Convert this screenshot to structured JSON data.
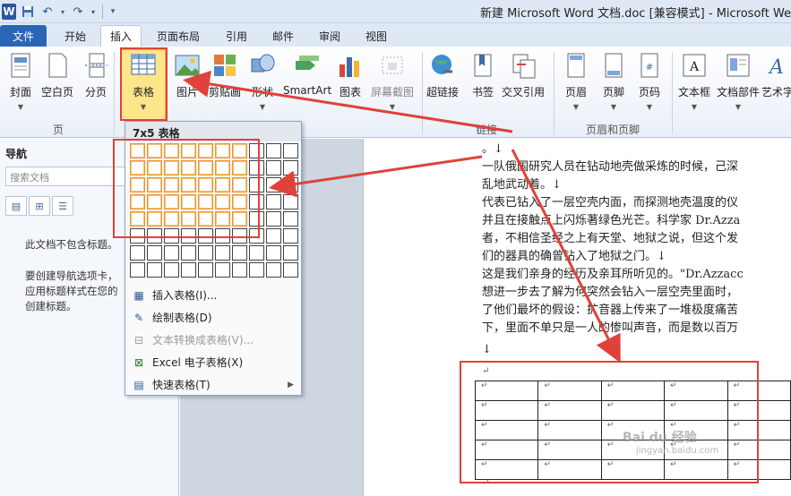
{
  "titlebar": {
    "logo": "W",
    "title": "新建 Microsoft Word 文档.doc [兼容模式] - Microsoft We"
  },
  "tabs": [
    {
      "label": "文件",
      "x": 0
    },
    {
      "label": "开始"
    },
    {
      "label": "插入"
    },
    {
      "label": "页面布局"
    },
    {
      "label": "引用"
    },
    {
      "label": "邮件"
    },
    {
      "label": "审阅"
    },
    {
      "label": "视图"
    }
  ],
  "ribbon": {
    "buttons": [
      {
        "label": "封面",
        "icon": "cover-page-icon"
      },
      {
        "label": "空白页",
        "icon": "blank-page-icon"
      },
      {
        "label": "分页",
        "icon": "page-break-icon"
      },
      {
        "label": "表格",
        "icon": "table-icon"
      },
      {
        "label": "图片",
        "icon": "picture-icon"
      },
      {
        "label": "剪贴画",
        "icon": "clip-art-icon"
      },
      {
        "label": "形状",
        "icon": "shapes-icon"
      },
      {
        "label": "SmartArt",
        "icon": "smartart-icon"
      },
      {
        "label": "图表",
        "icon": "chart-icon"
      },
      {
        "label": "屏幕截图",
        "icon": "screenshot-icon"
      },
      {
        "label": "超链接",
        "icon": "hyperlink-icon"
      },
      {
        "label": "书签",
        "icon": "bookmark-icon"
      },
      {
        "label": "交叉引用",
        "icon": "cross-reference-icon"
      },
      {
        "label": "页眉",
        "icon": "header-icon"
      },
      {
        "label": "页脚",
        "icon": "footer-icon"
      },
      {
        "label": "页码",
        "icon": "page-number-icon"
      },
      {
        "label": "文本框",
        "icon": "text-box-icon"
      },
      {
        "label": "文档部件",
        "icon": "quick-parts-icon"
      },
      {
        "label": "艺术字",
        "icon": "wordart-icon"
      }
    ],
    "groups": [
      "页",
      "链接",
      "页眉和页脚"
    ]
  },
  "nav": {
    "title": "导航",
    "search_placeholder": "搜索文档",
    "line1": "此文档不包含标题。",
    "line2": "要创建导航选项卡，",
    "line3": "应用标题样式在您的",
    "line4": "创建标题。"
  },
  "dropdown": {
    "header": "7x5 表格",
    "grid_cols": 10,
    "grid_rows": 8,
    "selected_cols": 7,
    "selected_rows": 5,
    "items": [
      {
        "label": "插入表格(I)...",
        "icon": "insert-table-icon",
        "disabled": false,
        "submenu": false
      },
      {
        "label": "绘制表格(D)",
        "icon": "draw-table-icon",
        "disabled": false,
        "submenu": false
      },
      {
        "label": "文本转换成表格(V)...",
        "icon": "convert-text-icon",
        "disabled": true,
        "submenu": false
      },
      {
        "label": "Excel 电子表格(X)",
        "icon": "excel-icon",
        "disabled": false,
        "submenu": false
      },
      {
        "label": "快速表格(T)",
        "icon": "quick-tables-icon",
        "disabled": false,
        "submenu": true
      }
    ]
  },
  "document": {
    "lines": [
      "。↓",
      "一队俄国研究人员在钻动地壳做采炼的时候，己深",
      "乱地武动着。↓",
      "代表已钻入了一层空壳内面，而探测地壳温度的仪",
      "并且在接触点上闪烁著绿色光芒。科学家 Dr.Azza",
      "者，不相信圣经之上有天堂、地狱之说，但这个发",
      "们的器具的确曾钻入了地狱之门。↓",
      "这是我们亲身的经历及亲耳所听见的。\"Dr.Azzacc",
      "想进一步去了解为何突然会钻入一层空壳里面时，",
      "了他们最坏的假设：扩音器上传来了一堆极度痛苦",
      "下，里面不单只是一人的惨叫声音，而是数以百万",
      "↓",
      "↵"
    ],
    "cell_mark": "↵",
    "table_rows": 5,
    "table_cols": 5,
    "after_table": "↵"
  },
  "watermark": {
    "line1": "Bai du 经验",
    "line2": "jingyan.baidu.com"
  },
  "colors": {
    "annotation_red": "#e0413a",
    "file_tab": "#2a66b5",
    "selected_cell": "#e8952d"
  }
}
